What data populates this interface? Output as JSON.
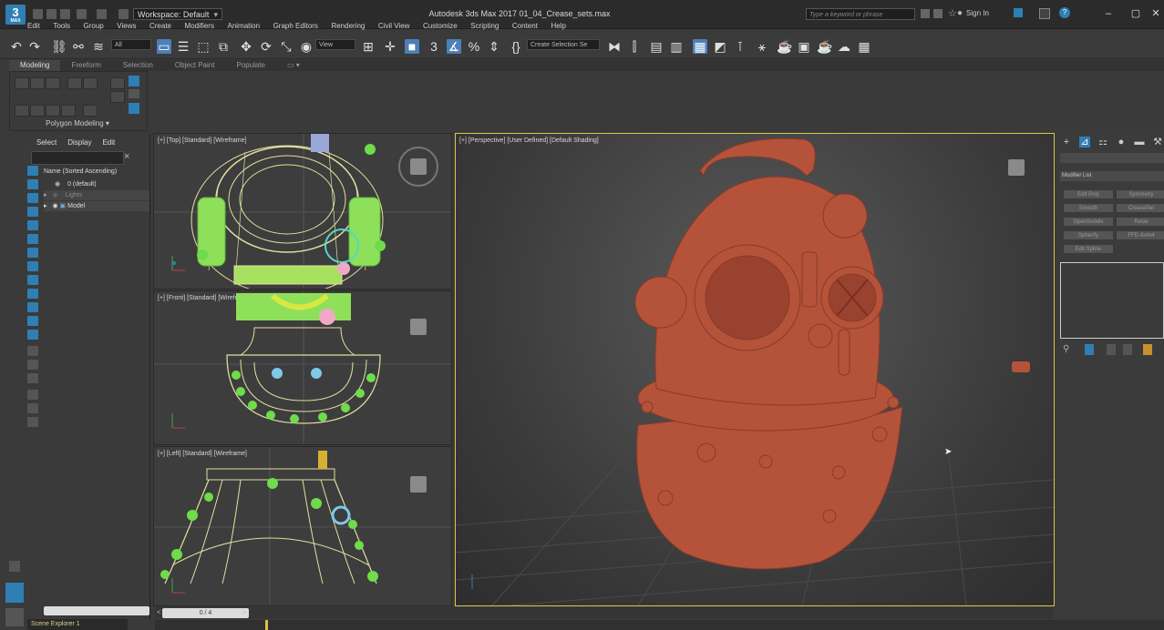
{
  "window": {
    "logo": "3",
    "logo_sub": "MAX",
    "workspace": "Workspace: Default",
    "title": "Autodesk 3ds Max 2017     01_04_Crease_sets.max",
    "search_placeholder": "Type a keyword or phrase",
    "sign_in": "Sign In"
  },
  "menu": [
    "Edit",
    "Tools",
    "Group",
    "Views",
    "Create",
    "Modifiers",
    "Animation",
    "Graph Editors",
    "Rendering",
    "Civil View",
    "Customize",
    "Scripting",
    "Content",
    "Help"
  ],
  "toolbar": {
    "filter_select": "All",
    "view_select": "View",
    "selection_set": "Create Selection Se"
  },
  "ribbon": {
    "tabs": [
      "Modeling",
      "Freeform",
      "Selection",
      "Object Paint",
      "Populate"
    ],
    "active_tab": "Modeling",
    "panel_label": "Polygon Modeling ▾"
  },
  "scene_explorer": {
    "tabs": [
      "Select",
      "Display",
      "Edit"
    ],
    "column_header": "Name (Sorted Ascending)",
    "rows": [
      "0 (default)",
      "Lights",
      "Model"
    ],
    "footer": "Scene Explorer 1"
  },
  "viewports": {
    "top": "[+] [Top] [Standard] [Wireframe]",
    "front": "[+] [Front] [Standard] [Wireframe]",
    "left": "[+] [Left] [Standard] [Wireframe]",
    "perspective": "[+] [Perspective] [User Defined] [Default Shading]"
  },
  "command_panel": {
    "modifier_list": "Modifier List",
    "buttons": [
      "Edit Poly",
      "Symmetry",
      "Smooth",
      "CreaseSet",
      "OpenSubdiv",
      "Relax",
      "Spherify",
      "FFD 4x4x4",
      "Edit Spline"
    ]
  },
  "timeline": {
    "frame": "0 / 4"
  },
  "colors": {
    "accent": "#2f7fb5",
    "active_viewport_border": "#d8c84a",
    "helmet": "#b4533a",
    "wire": "#e0e0a0",
    "green": "#6fdc4a"
  }
}
